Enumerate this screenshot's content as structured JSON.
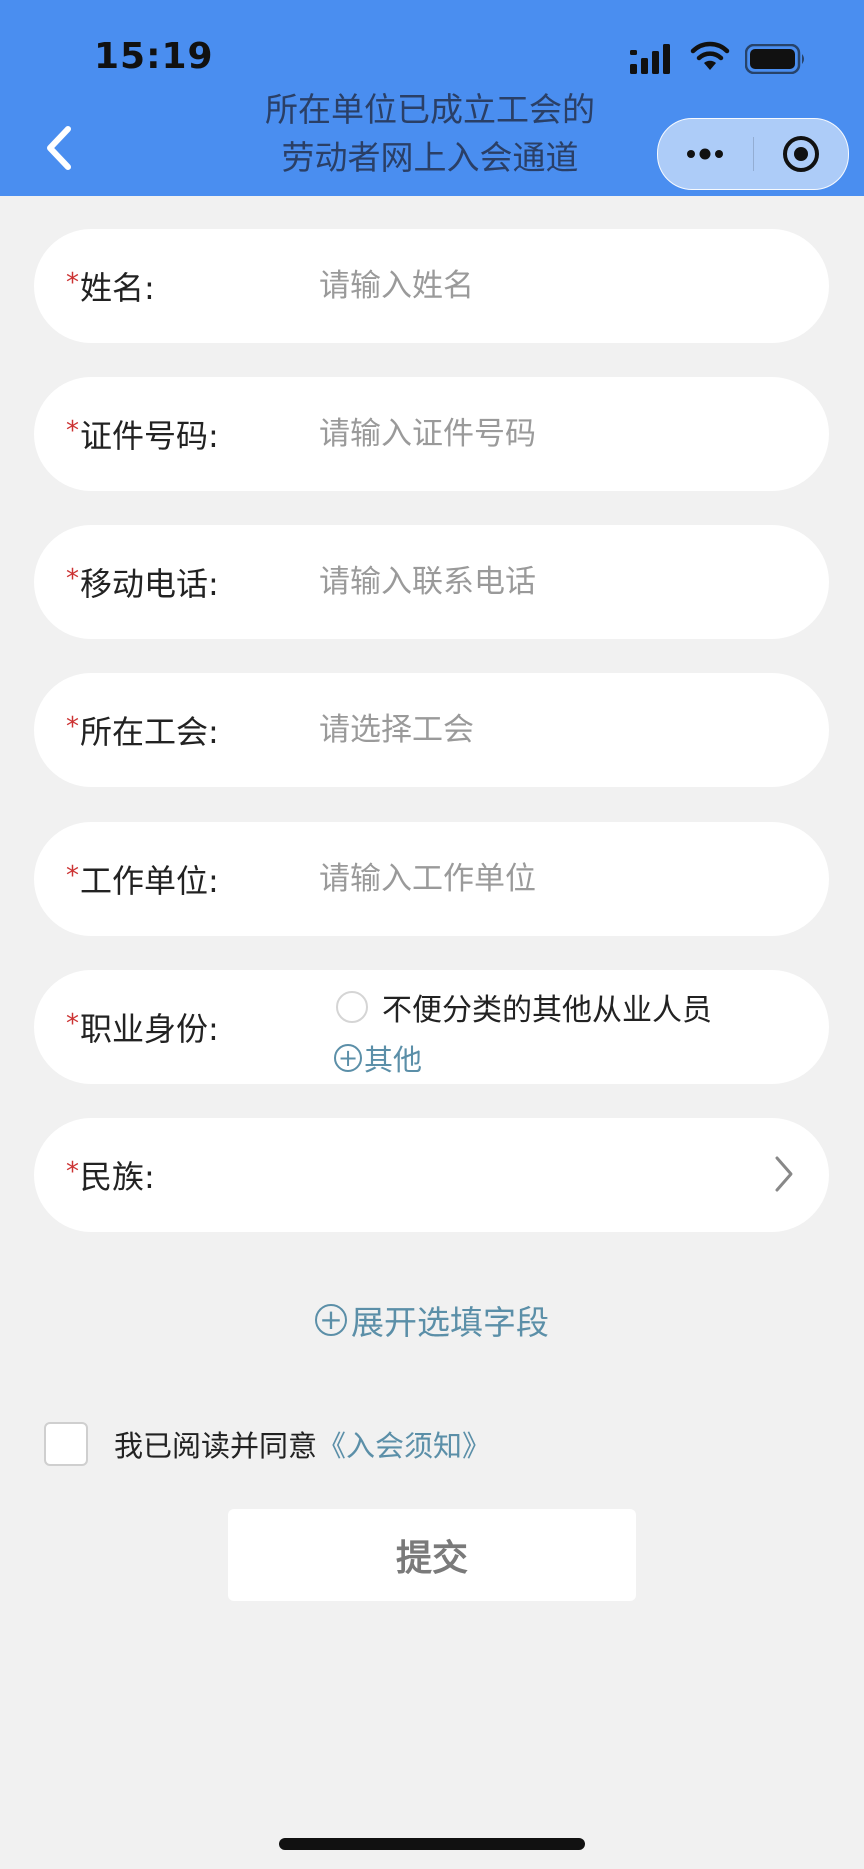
{
  "status_bar": {
    "time": "15:19"
  },
  "nav": {
    "title_line1": "所在单位已成立工会的",
    "title_line2": "劳动者网上入会通道"
  },
  "form": {
    "required_mark": "*",
    "fields": [
      {
        "label": "姓名:",
        "placeholder": "请输入姓名"
      },
      {
        "label": "证件号码:",
        "placeholder": "请输入证件号码"
      },
      {
        "label": "移动电话:",
        "placeholder": "请输入联系电话"
      },
      {
        "label": "所在工会:",
        "placeholder": "请选择工会"
      },
      {
        "label": "工作单位:",
        "placeholder": "请输入工作单位"
      }
    ],
    "occupation": {
      "label": "职业身份:",
      "option": "不便分类的其他从业人员",
      "other": "其他"
    },
    "ethnicity": {
      "label": "民族:"
    }
  },
  "expand": {
    "label": "展开选填字段"
  },
  "agreement": {
    "text": "我已阅读并同意",
    "link": "《入会须知》"
  },
  "submit": {
    "label": "提交"
  },
  "colors": {
    "header": "#4a8ef0",
    "link": "#5b8fa8",
    "required": "#cc3333",
    "background": "#f1f1f1"
  }
}
